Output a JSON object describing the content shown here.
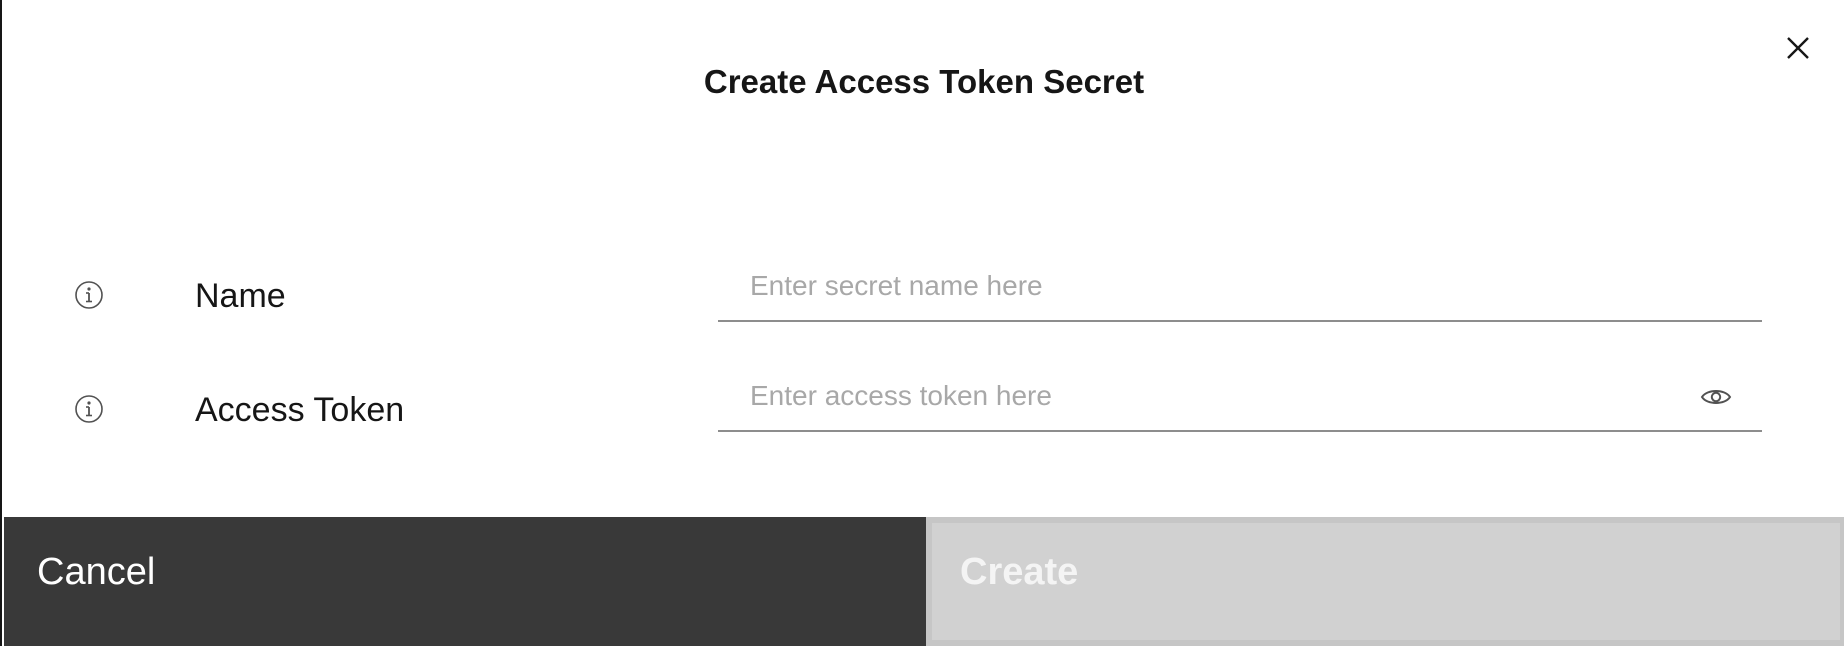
{
  "modal": {
    "title": "Create Access Token Secret",
    "close_icon": "close-icon"
  },
  "fields": {
    "name": {
      "label": "Name",
      "placeholder": "Enter secret name here",
      "value": "",
      "info_icon": "info-icon"
    },
    "access_token": {
      "label": "Access Token",
      "placeholder": "Enter access token here",
      "value": "",
      "info_icon": "info-icon",
      "visibility_icon": "eye-icon"
    }
  },
  "footer": {
    "cancel_label": "Cancel",
    "create_label": "Create",
    "create_disabled": true
  },
  "colors": {
    "cancel_bg": "#393939",
    "create_disabled_bg": "#d1d1d1",
    "text": "#161616",
    "placeholder": "#a8a8a8"
  }
}
